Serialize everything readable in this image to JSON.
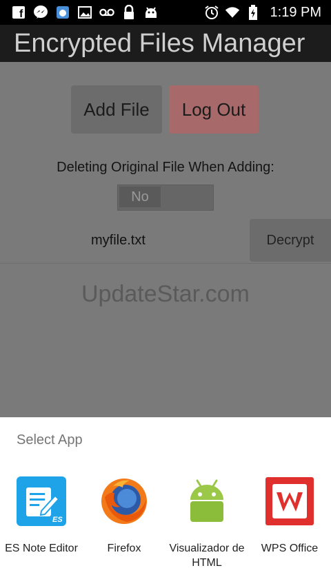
{
  "status_bar": {
    "time": "1:19 PM",
    "icons_left": [
      "facebook-icon",
      "messenger-icon",
      "weather-icon",
      "image-icon",
      "voicemail-icon",
      "lock-icon",
      "android-icon"
    ],
    "icons_right": [
      "alarm-icon",
      "wifi-icon",
      "battery-icon"
    ]
  },
  "app": {
    "title": "Encrypted Files Manager",
    "add_file_label": "Add File",
    "logout_label": "Log Out",
    "delete_label": "Deleting Original File When Adding:",
    "toggle_value": "No",
    "file_name": "myfile.txt",
    "decrypt_label": "Decrypt",
    "watermark": "UpdateStar.com"
  },
  "sheet": {
    "title": "Select App",
    "apps": [
      {
        "label": "ES Note Editor"
      },
      {
        "label": "Firefox"
      },
      {
        "label": "Visualizador de HTML"
      },
      {
        "label": "WPS Office"
      }
    ]
  },
  "colors": {
    "logout_button": "#a76969",
    "wps_red": "#e0302e",
    "es_blue": "#1fa3e8",
    "android_green": "#9bc848"
  }
}
